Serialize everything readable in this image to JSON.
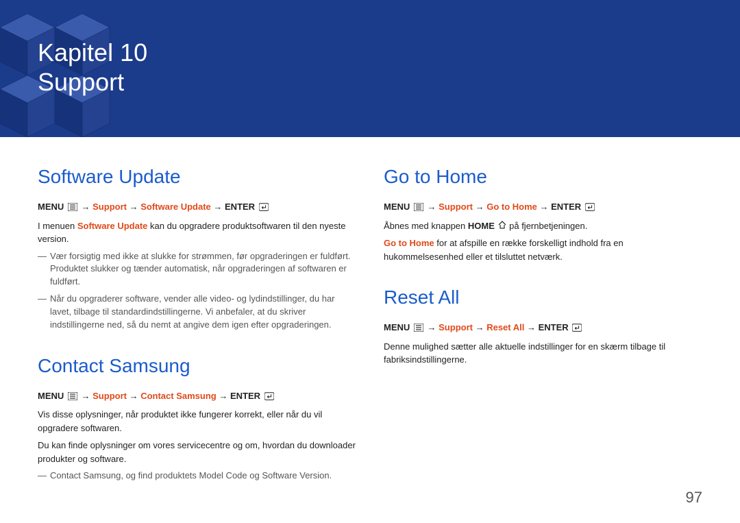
{
  "header": {
    "chapter": "Kapitel 10",
    "title": "Support"
  },
  "left": {
    "section1": {
      "heading": "Software Update",
      "path": {
        "menu": "MENU",
        "support": "Support",
        "item": "Software Update",
        "enter": "ENTER"
      },
      "intro_pre": "I menuen ",
      "intro_hl": "Software Update",
      "intro_post": " kan du opgradere produktsoftwaren til den nyeste version.",
      "note1": "Vær forsigtig med ikke at slukke for strømmen, før opgraderingen er fuldført. Produktet slukker og tænder automatisk, når opgraderingen af softwaren er fuldført.",
      "note2": "Når du opgraderer software, vender alle video- og lydindstillinger, du har lavet, tilbage til standardindstillingerne. Vi anbefaler, at du skriver indstillingerne ned, så du nemt at angive dem igen efter opgraderingen."
    },
    "section2": {
      "heading": "Contact Samsung",
      "path": {
        "menu": "MENU",
        "support": "Support",
        "item": "Contact Samsung",
        "enter": "ENTER"
      },
      "p1": "Vis disse oplysninger, når produktet ikke fungerer korrekt, eller når du vil opgradere softwaren.",
      "p2": "Du kan finde oplysninger om vores servicecentre og om, hvordan du downloader produkter og software.",
      "note_hl1": "Contact Samsung",
      "note_mid": ", og find produktets ",
      "note_hl2": "Model Code",
      "note_og": " og ",
      "note_hl3": "Software Version",
      "note_end": "."
    }
  },
  "right": {
    "section1": {
      "heading": "Go to Home",
      "path": {
        "menu": "MENU",
        "support": "Support",
        "item": "Go to Home",
        "enter": "ENTER"
      },
      "p1_pre": "Åbnes med knappen ",
      "p1_b": "HOME",
      "p1_post": " på fjernbetjeningen.",
      "p2_hl": "Go to Home",
      "p2_post": " for at afspille en række forskelligt indhold fra en hukommelsesenhed eller et tilsluttet netværk."
    },
    "section2": {
      "heading": "Reset All",
      "path": {
        "menu": "MENU",
        "support": "Support",
        "item": "Reset All",
        "enter": "ENTER"
      },
      "p1": "Denne mulighed sætter alle aktuelle indstillinger for en skærm tilbage til fabriksindstillingerne."
    }
  },
  "pagenum": "97"
}
